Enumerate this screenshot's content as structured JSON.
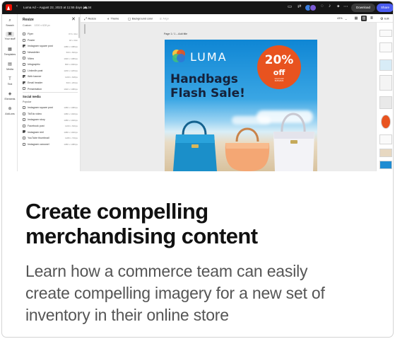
{
  "app": {
    "title": "Luma Ad – August 22, 2023 at 11:55 days (4) 34",
    "download_label": "Download",
    "share_label": "Share"
  },
  "rail": {
    "items": [
      {
        "label": "Search",
        "icon": "search-icon"
      },
      {
        "label": "Your stuff",
        "icon": "folder-icon"
      },
      {
        "label": "Templates",
        "icon": "templates-icon"
      },
      {
        "label": "Media",
        "icon": "media-icon"
      },
      {
        "label": "Text",
        "icon": "text-icon"
      },
      {
        "label": "Elements",
        "icon": "elements-icon"
      },
      {
        "label": "Add-ons",
        "icon": "addons-icon"
      }
    ]
  },
  "panel": {
    "title": "Resize",
    "close": "✕",
    "tab_custom": "Custom",
    "tab_dims": "1200 x 628 px",
    "formats": [
      {
        "label": "Flyer",
        "size": "8.5 x 11in",
        "checked": false
      },
      {
        "label": "Poster",
        "size": "18 x 24in",
        "checked": false
      },
      {
        "label": "Instagram square post",
        "size": "1080 x 1080px",
        "checked": true
      },
      {
        "label": "Newsletter",
        "size": "600 x 600px",
        "checked": false
      },
      {
        "label": "Video",
        "size": "1920 x 1080px",
        "checked": false
      },
      {
        "label": "Infographic",
        "size": "800 x 2000px",
        "checked": false
      },
      {
        "label": "LinkedIn post",
        "size": "1200 x 1200px",
        "checked": false
      },
      {
        "label": "Web banner",
        "size": "1200 x 628px",
        "checked": true
      },
      {
        "label": "Email header",
        "size": "600 x 200px",
        "checked": true
      },
      {
        "label": "Presentation",
        "size": "1920 x 1080px",
        "checked": false
      }
    ],
    "social_heading": "Social media",
    "social_sub": "Popular",
    "social": [
      {
        "label": "Instagram square post",
        "size": "1080 x 1080px",
        "checked": false
      },
      {
        "label": "TikTok video",
        "size": "1080 x 1920px",
        "checked": false
      },
      {
        "label": "Instagram story",
        "size": "1080 x 1920px",
        "checked": false
      },
      {
        "label": "Facebook post",
        "size": "1200 x 630px",
        "checked": false
      },
      {
        "label": "Instagram reel",
        "size": "1080 x 1920px",
        "checked": true
      },
      {
        "label": "YouTube thumbnail",
        "size": "1280 x 720px",
        "checked": false
      },
      {
        "label": "Instagram carousel",
        "size": "1080 x 1080px",
        "checked": false
      }
    ]
  },
  "canvas_toolbar": {
    "resize": "Resize",
    "theme": "Theme",
    "background": "Background color",
    "align": "Align",
    "zoom": "43%",
    "edit": "Edit"
  },
  "canvas": {
    "page_label": "Page 1 / 1 – Add title"
  },
  "design": {
    "brand": "LUMA",
    "headline_line1": "Handbags",
    "headline_line2": "Flash Sale!",
    "badge_percent": "20%",
    "badge_off": "off",
    "badge_fine1": "Good until",
    "badge_fine2": "8/25/2023",
    "colors": {
      "badge": "#e8531f",
      "headline": "#15213a",
      "sky": "#1f8cd2"
    }
  },
  "heading_line1": "Create compelling",
  "heading_line2": "merchandising content",
  "description_line1": "Learn how a commerce team can easily",
  "description_line2": "create compelling imagery for a new set of",
  "description_line3": "inventory in their online store"
}
